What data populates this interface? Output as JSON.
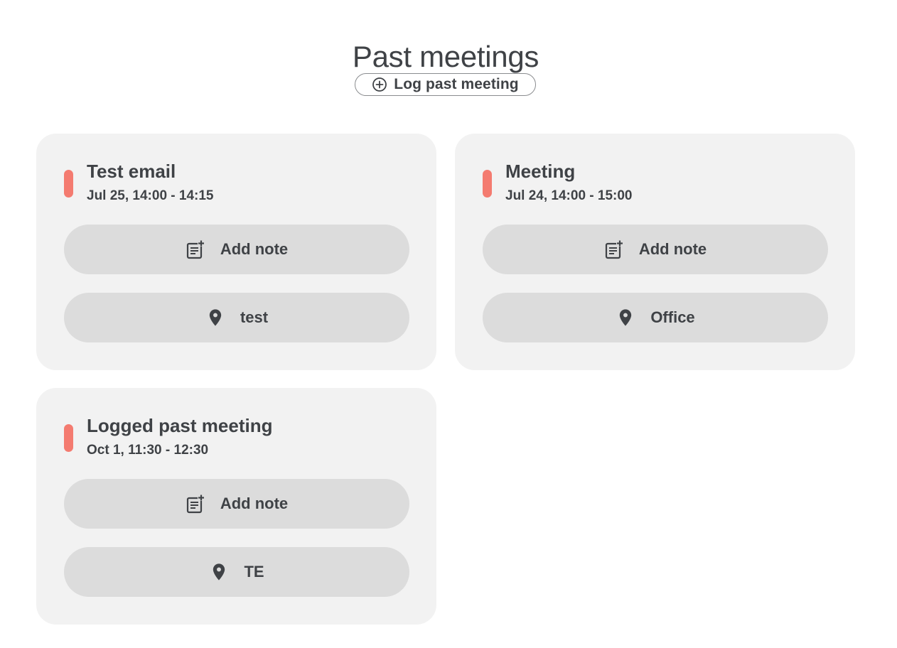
{
  "page": {
    "title": "Past meetings",
    "log_button_label": "Log past meeting"
  },
  "colors": {
    "accent": "#f47b70",
    "card_bg": "#f2f2f2",
    "pill_bg": "#dcdcdc",
    "text": "#3f4246"
  },
  "meetings": [
    {
      "title": "Test email",
      "time": "Jul 25, 14:00 - 14:15",
      "note_label": "Add note",
      "location": "test",
      "note_icon": "note-add-icon",
      "location_icon": "location-pin-icon"
    },
    {
      "title": "Meeting",
      "time": "Jul 24, 14:00 - 15:00",
      "note_label": "Add note",
      "location": "Office",
      "note_icon": "note-add-icon",
      "location_icon": "location-pin-icon"
    },
    {
      "title": "Logged past meeting",
      "time": "Oct 1, 11:30 - 12:30",
      "note_label": "Add note",
      "location": "TE",
      "note_icon": "note-add-icon",
      "location_icon": "location-pin-icon"
    }
  ]
}
